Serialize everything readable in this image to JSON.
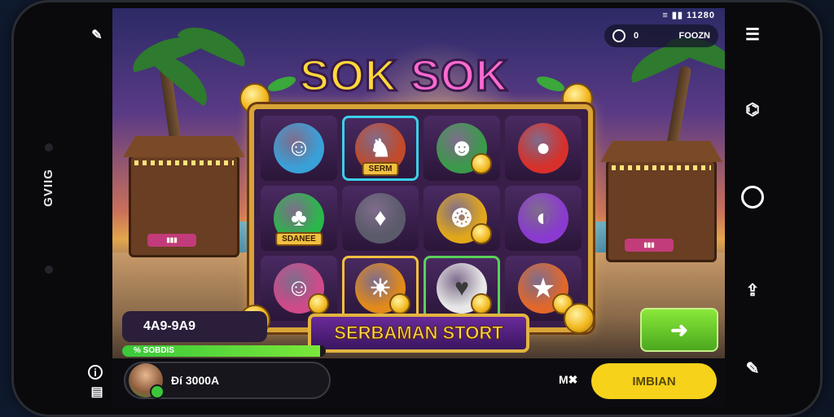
{
  "status_bar": {
    "time": "11280",
    "signal": "≡ ▮▮"
  },
  "top_pill": {
    "count": "0",
    "label": "FOOZN"
  },
  "game": {
    "title_left": "SOK",
    "title_right": "SOK",
    "start_button": "SERBAMAN STORT"
  },
  "reels": [
    {
      "symbol": "☺",
      "label": "",
      "bg": "#3aa0d8",
      "highlight": "none"
    },
    {
      "symbol": "♞",
      "label": "SERM",
      "bg": "#c24a2a",
      "highlight": "cyan"
    },
    {
      "symbol": "☻",
      "label": "",
      "bg": "#3a9a4a",
      "highlight": "none"
    },
    {
      "symbol": "●",
      "label": "",
      "bg": "#d8302a",
      "highlight": "none"
    },
    {
      "symbol": "♣",
      "label": "SDANEE",
      "bg": "#2ab84a",
      "highlight": "none"
    },
    {
      "symbol": "♦",
      "label": "",
      "bg": "#5a5a6a",
      "highlight": "none"
    },
    {
      "symbol": "❂",
      "label": "",
      "bg": "#e2a81a",
      "highlight": "none"
    },
    {
      "symbol": "◐",
      "label": "",
      "bg": "#8a3ad0",
      "highlight": "none"
    },
    {
      "symbol": "☺",
      "label": "",
      "bg": "#d04a8a",
      "highlight": "none"
    },
    {
      "symbol": "☀",
      "label": "",
      "bg": "#e28a1a",
      "highlight": "gold"
    },
    {
      "symbol": "♥",
      "label": "",
      "bg": "#e8e8e8",
      "highlight": "green"
    },
    {
      "symbol": "★",
      "label": "",
      "bg": "#e2682a",
      "highlight": "none"
    }
  ],
  "balance": {
    "value": "4A9-9A9"
  },
  "xp": {
    "label": "% SOBDIS",
    "progress": 0.97
  },
  "go_button": {
    "label": "➜"
  },
  "player": {
    "name": "Ðí 3000A"
  },
  "bottom": {
    "ms_label": "M✖",
    "yellow_button": "IMBIAN"
  },
  "bezel": {
    "brand": "GVIIG"
  },
  "colors": {
    "accent": "#f6d21a",
    "frame": "#d9a436",
    "go": "#4aa81e"
  }
}
